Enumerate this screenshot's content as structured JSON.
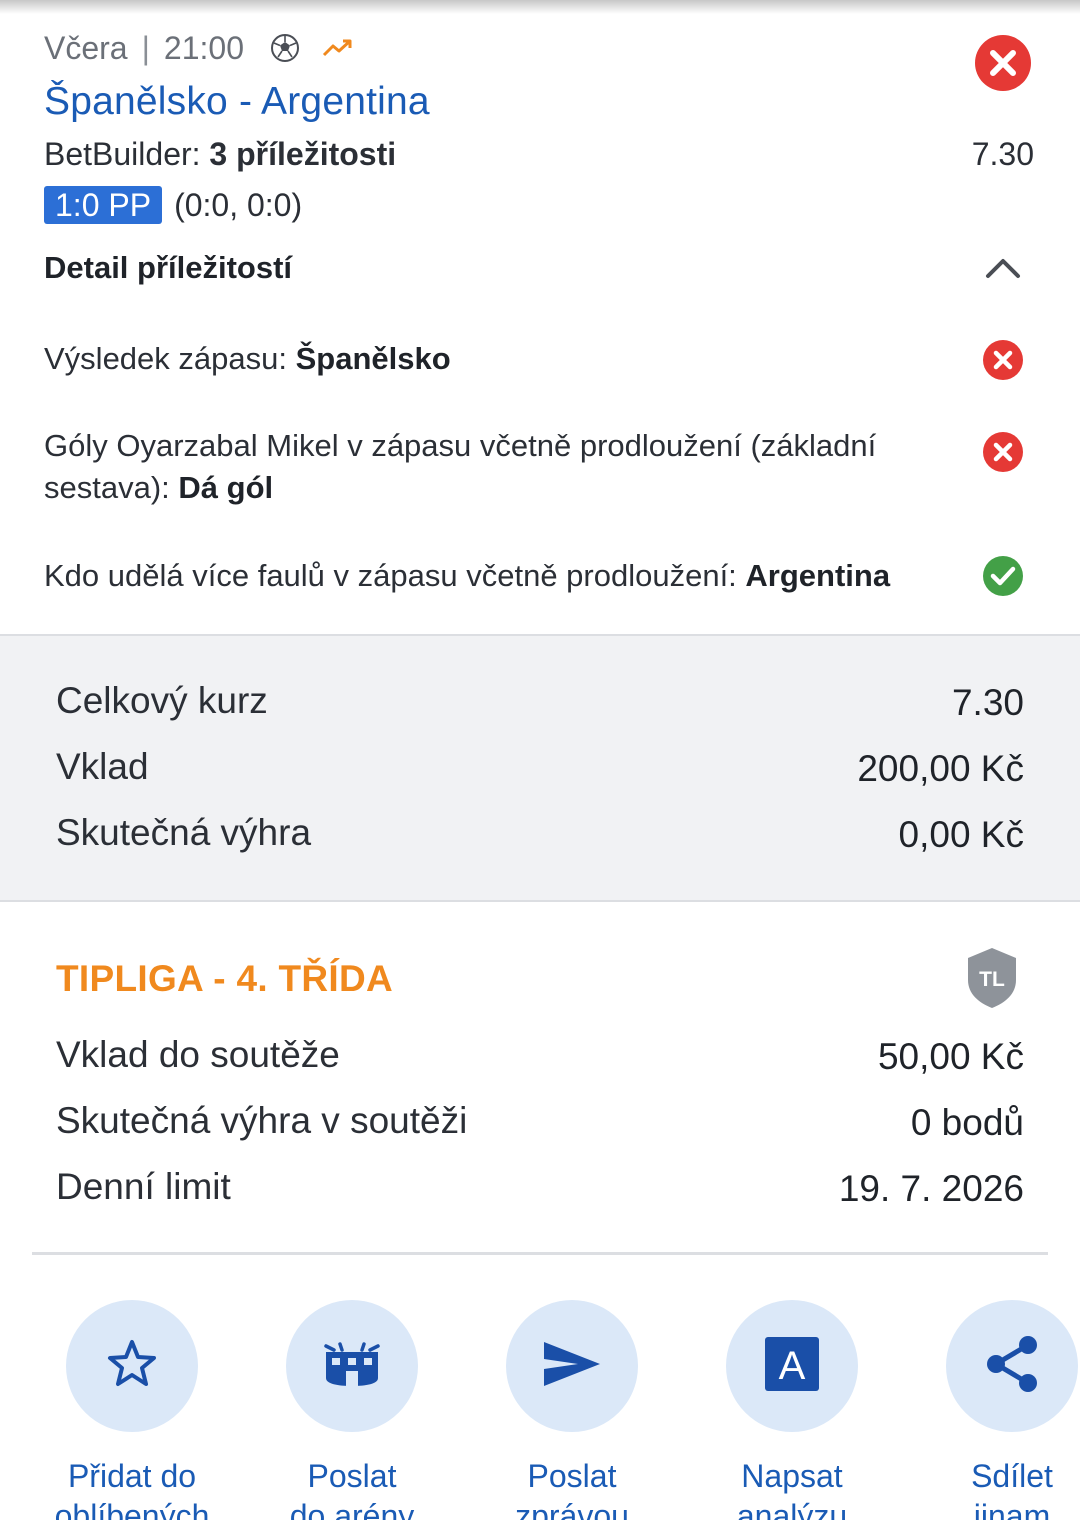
{
  "header": {
    "date": "Včera",
    "separator": "|",
    "time": "21:00",
    "sport_icon": "football-icon",
    "trend_icon": "trending-up-icon",
    "match_title": "Španělsko - Argentina",
    "status_icon": "lost-x-icon"
  },
  "bet": {
    "type_label": "BetBuilder:",
    "type_value": "3 příležitosti",
    "odds": "7.30",
    "score_badge": "1:0 PP",
    "score_detail": "(0:0, 0:0)"
  },
  "detail": {
    "heading": "Detail příležitostí",
    "legs": [
      {
        "market": "Výsledek zápasu: ",
        "pick": "Španělsko",
        "status": "lost"
      },
      {
        "market": "Góly Oyarzabal Mikel v zápasu včetně prodloužení (základní sestava): ",
        "pick": "Dá gól",
        "status": "lost"
      },
      {
        "market": "Kdo udělá více faulů v zápasu včetně prodloužení: ",
        "pick": "Argentina",
        "status": "won"
      }
    ]
  },
  "summary": {
    "total_odds_label": "Celkový kurz",
    "total_odds_value": "7.30",
    "stake_label": "Vklad",
    "stake_value": "200,00 Kč",
    "win_label": "Skutečná výhra",
    "win_value": "0,00 Kč"
  },
  "tipliga": {
    "title": "TIPLIGA - 4. TŘÍDA",
    "badge_text": "TL",
    "stake_label": "Vklad do soutěže",
    "stake_value": "50,00 Kč",
    "win_label": "Skutečná výhra v soutěži",
    "win_value": "0 bodů",
    "limit_label": "Denní limit",
    "limit_value": "19. 7. 2026"
  },
  "actions": [
    {
      "icon": "star-icon",
      "label_line1": "Přidat do",
      "label_line2": "oblíbených"
    },
    {
      "icon": "stadium-icon",
      "label_line1": "Poslat",
      "label_line2": "do arény"
    },
    {
      "icon": "send-icon",
      "label_line1": "Poslat",
      "label_line2": "zprávou"
    },
    {
      "icon": "analysis-a-icon",
      "label_line1": "Napsat",
      "label_line2": "analýzu"
    },
    {
      "icon": "share-icon",
      "label_line1": "Sdílet",
      "label_line2": "jinam"
    }
  ],
  "colors": {
    "accent_blue": "#1a5bb5",
    "lost_red": "#e53935",
    "won_green": "#43a047",
    "tipliga_orange": "#f0891e",
    "action_bg": "#dbe8f8"
  }
}
